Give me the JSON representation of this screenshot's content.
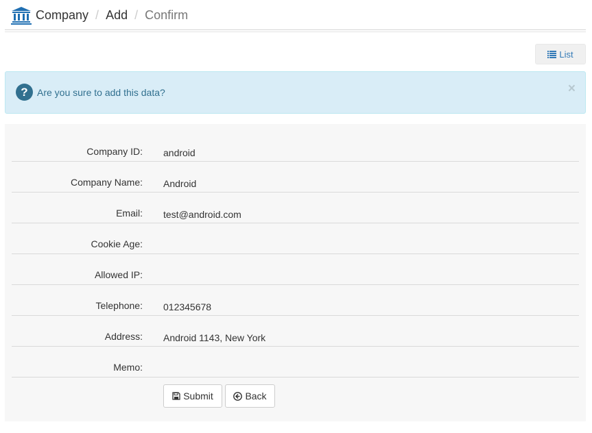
{
  "breadcrumb": [
    "Company",
    "Add",
    "Confirm"
  ],
  "list_button": "List",
  "alert": {
    "message": "Are you sure to add this data?",
    "close": "×"
  },
  "fields": [
    {
      "label": "Company ID:",
      "value": "android"
    },
    {
      "label": "Company Name:",
      "value": "Android"
    },
    {
      "label": "Email:",
      "value": "test@android.com"
    },
    {
      "label": "Cookie Age:",
      "value": ""
    },
    {
      "label": "Allowed IP:",
      "value": ""
    },
    {
      "label": "Telephone:",
      "value": "012345678"
    },
    {
      "label": "Address:",
      "value": "Android 1143, New York"
    },
    {
      "label": "Memo:",
      "value": ""
    }
  ],
  "buttons": {
    "submit": "Submit",
    "back": "Back"
  },
  "colors": {
    "brand_icon": "#1f6fb2",
    "link": "#337ab7",
    "alert_bg": "#d9edf7",
    "alert_text": "#31708f",
    "panel_bg": "#f7f7f7"
  },
  "icons": {
    "brand": "bank-icon",
    "list": "list-icon",
    "alert": "question-circle-icon",
    "submit": "floppy-disk-icon",
    "back": "circle-arrow-left-icon"
  }
}
